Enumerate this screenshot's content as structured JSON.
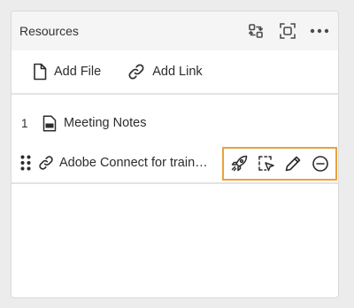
{
  "panel": {
    "title": "Resources",
    "header_icons": [
      "swap-icon",
      "fit-screen-icon",
      "more-icon"
    ]
  },
  "toolbar": {
    "add_file_label": "Add File",
    "add_link_label": "Add Link"
  },
  "resources": [
    {
      "index": "1",
      "type": "pdf",
      "name": "Meeting Notes"
    },
    {
      "index": "",
      "type": "link",
      "name": "Adobe Connect for traini..."
    }
  ],
  "row_actions": [
    "launch-icon",
    "select-icon",
    "edit-icon",
    "remove-icon"
  ],
  "colors": {
    "highlight": "#e8a33b"
  }
}
